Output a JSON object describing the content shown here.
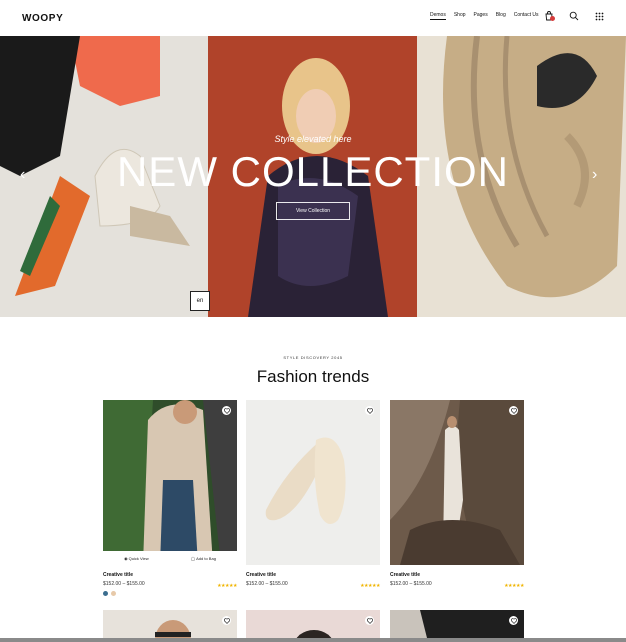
{
  "header": {
    "logo": "WOOPY",
    "nav": [
      "Demos",
      "Shop",
      "Pages",
      "Blog",
      "Contact Us"
    ]
  },
  "hero": {
    "subtitle": "Style elevated here",
    "title": "NEW COLLECTION",
    "button_label": "View Collection",
    "badge_text": "en"
  },
  "section": {
    "eyebrow": "STYLE DISCOVERY 2045",
    "title": "Fashion trends"
  },
  "products": [
    {
      "title": "Creative title",
      "price": "$152.00 – $155.00",
      "quick_view": "Quick View",
      "add_to_bag": "Add to Bag"
    },
    {
      "title": "Creative title",
      "price": "$152.00 – $155.00"
    },
    {
      "title": "Creative title",
      "price": "$152.00 – $155.00"
    }
  ],
  "colors": {
    "star": "#f0b400",
    "cart_badge": "#d63b3b",
    "swatch_1": "#3c6e8f",
    "swatch_2": "#e7c9a9"
  }
}
